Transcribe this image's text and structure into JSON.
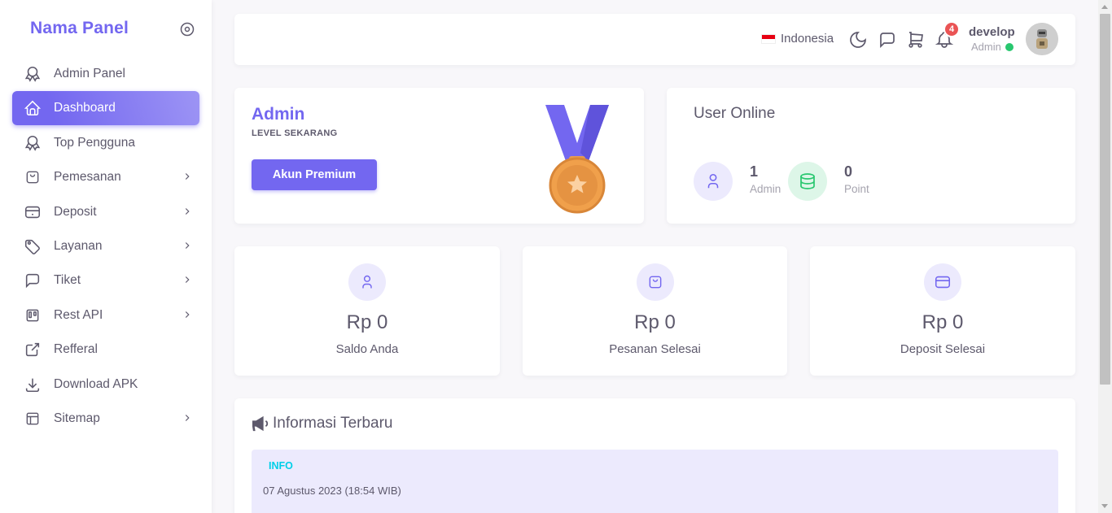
{
  "brand": "Nama Panel",
  "sidebar": {
    "items": [
      {
        "label": "Admin Panel",
        "icon": "award-icon"
      },
      {
        "label": "Dashboard",
        "icon": "home-icon",
        "active": true
      },
      {
        "label": "Top Pengguna",
        "icon": "award-icon"
      },
      {
        "label": "Pemesanan",
        "icon": "shopping-bag-icon",
        "submenu": true
      },
      {
        "label": "Deposit",
        "icon": "credit-card-icon",
        "submenu": true
      },
      {
        "label": "Layanan",
        "icon": "tag-icon",
        "submenu": true
      },
      {
        "label": "Tiket",
        "icon": "message-square-icon",
        "submenu": true
      },
      {
        "label": "Rest API",
        "icon": "trello-icon",
        "submenu": true
      },
      {
        "label": "Refferal",
        "icon": "external-link-icon"
      },
      {
        "label": "Download APK",
        "icon": "download-icon"
      },
      {
        "label": "Sitemap",
        "icon": "layout-icon",
        "submenu": true
      }
    ]
  },
  "topbar": {
    "language": "Indonesia",
    "notification_count": "4",
    "user_name": "develop",
    "user_role": "Admin"
  },
  "level_card": {
    "title": "Admin",
    "subtitle": "LEVEL SEKARANG",
    "button": "Akun Premium"
  },
  "online_card": {
    "title": "User Online",
    "admin_count": "1",
    "admin_label": "Admin",
    "point_count": "0",
    "point_label": "Point"
  },
  "stats": [
    {
      "value": "Rp 0",
      "label": "Saldo Anda",
      "icon": "user-icon"
    },
    {
      "value": "Rp 0",
      "label": "Pesanan Selesai",
      "icon": "shopping-bag-icon"
    },
    {
      "value": "Rp 0",
      "label": "Deposit Selesai",
      "icon": "credit-card-icon"
    }
  ],
  "info": {
    "title": "Informasi Terbaru",
    "tag": "INFO",
    "date": "07 Agustus 2023 (18:54 WIB)"
  },
  "colors": {
    "primary": "#7367f0",
    "success": "#28c76f",
    "danger": "#ea5455",
    "info": "#00cfe8"
  }
}
